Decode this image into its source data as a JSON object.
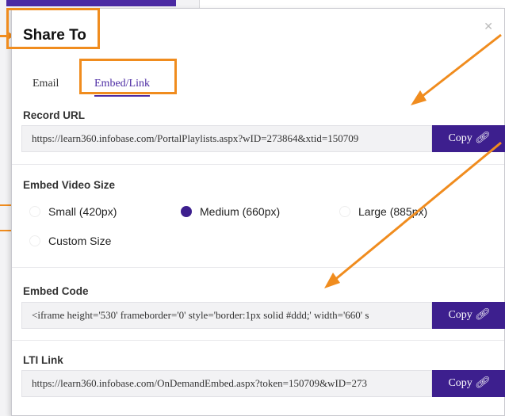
{
  "modal": {
    "title": "Share To",
    "close_icon": "close-icon",
    "tabs": [
      {
        "label": "Email"
      },
      {
        "label": "Embed/Link"
      }
    ]
  },
  "record_url": {
    "label": "Record URL",
    "value": "https://learn360.infobase.com/PortalPlaylists.aspx?wID=273864&xtid=150709",
    "copy_label": "Copy"
  },
  "embed_size": {
    "label": "Embed Video Size",
    "options": [
      {
        "label": "Small (420px)",
        "selected": false
      },
      {
        "label": "Medium (660px)",
        "selected": true
      },
      {
        "label": "Large (885px)",
        "selected": false
      },
      {
        "label": "Custom Size",
        "selected": false
      }
    ]
  },
  "embed_code": {
    "label": "Embed Code",
    "value": "<iframe height='530' frameborder='0' style='border:1px solid #ddd;' width='660' s",
    "copy_label": "Copy"
  },
  "lti_link": {
    "label": "LTI Link",
    "value": "https://learn360.infobase.com/OnDemandEmbed.aspx?token=150709&wID=273",
    "copy_label": "Copy"
  },
  "colors": {
    "accent": "#3d1f8e",
    "highlight": "#f08c1e"
  }
}
